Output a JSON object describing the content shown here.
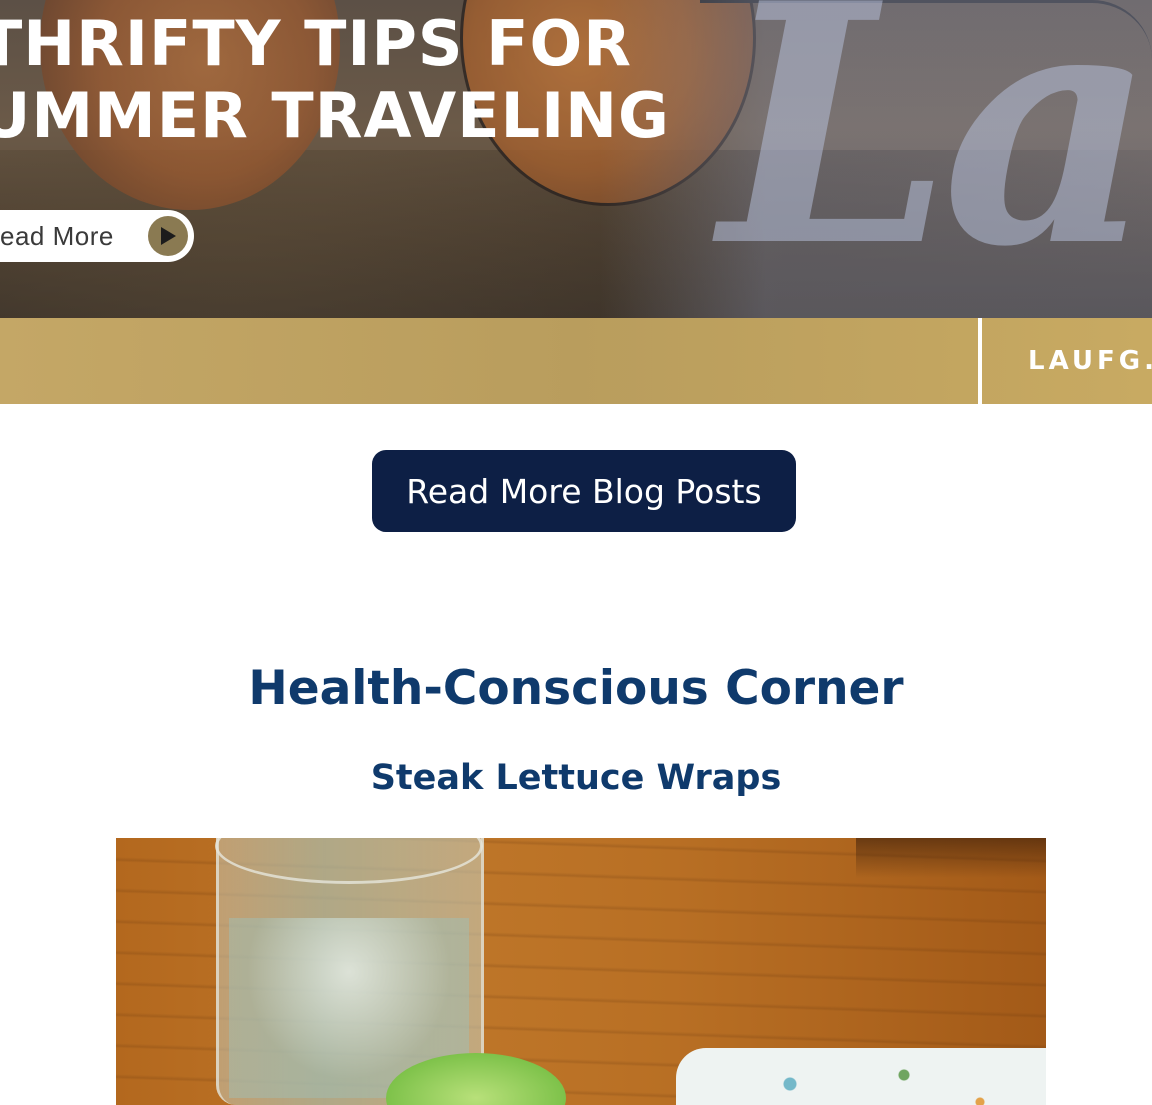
{
  "hero": {
    "title_line1": "THRIFTY TIPS FOR",
    "title_line2": "UMMER TRAVELING",
    "read_more_label": "ead More",
    "script_text": "Lau",
    "arrow_icon": "play-icon"
  },
  "gold_bar": {
    "site_text": "LAUFG."
  },
  "blog_button": {
    "label": "Read More Blog Posts"
  },
  "health_section": {
    "title": "Health-Conscious Corner",
    "recipe_title": "Steak Lettuce Wraps"
  },
  "colors": {
    "gold": "#bfa35f",
    "navy_button": "#0d1f45",
    "heading_blue": "#0f3a6c"
  }
}
